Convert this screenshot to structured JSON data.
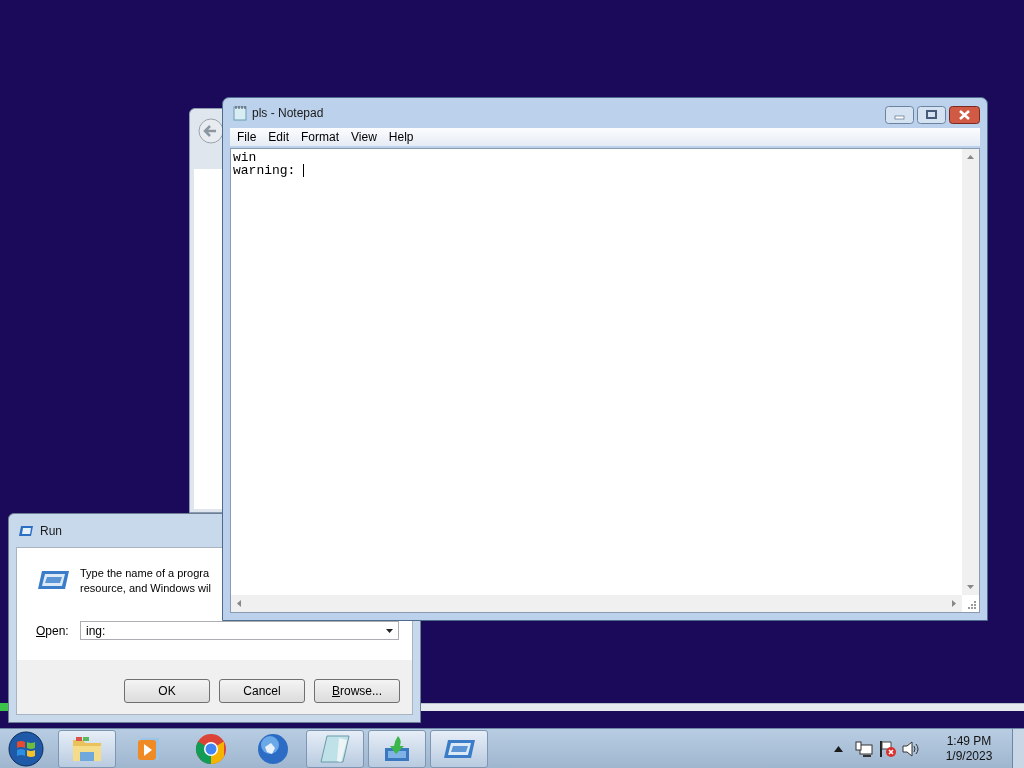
{
  "notepad": {
    "title": "pls - Notepad",
    "menu": [
      "File",
      "Edit",
      "Format",
      "View",
      "Help"
    ],
    "lines": [
      "win",
      "warning: "
    ]
  },
  "run_dialog": {
    "title": "Run",
    "description": [
      "Type the name of a progra",
      "resource, and Windows wil"
    ],
    "open_label": {
      "text": "Open:",
      "underline_first": true
    },
    "open_value": "ing:",
    "buttons": [
      {
        "label": "OK",
        "underline_first": false
      },
      {
        "label": "Cancel",
        "underline_first": false
      },
      {
        "label": "Browse...",
        "underline_first": true
      }
    ]
  },
  "taskbar": {
    "items": [
      {
        "kind": "explorer",
        "running": true
      },
      {
        "kind": "media",
        "running": false
      },
      {
        "kind": "chrome",
        "running": false
      },
      {
        "kind": "globe",
        "running": false
      },
      {
        "kind": "notepad",
        "running": true
      },
      {
        "kind": "download",
        "running": true
      },
      {
        "kind": "run",
        "running": true
      }
    ],
    "time": "1:49 PM",
    "date": "1/9/2023"
  }
}
